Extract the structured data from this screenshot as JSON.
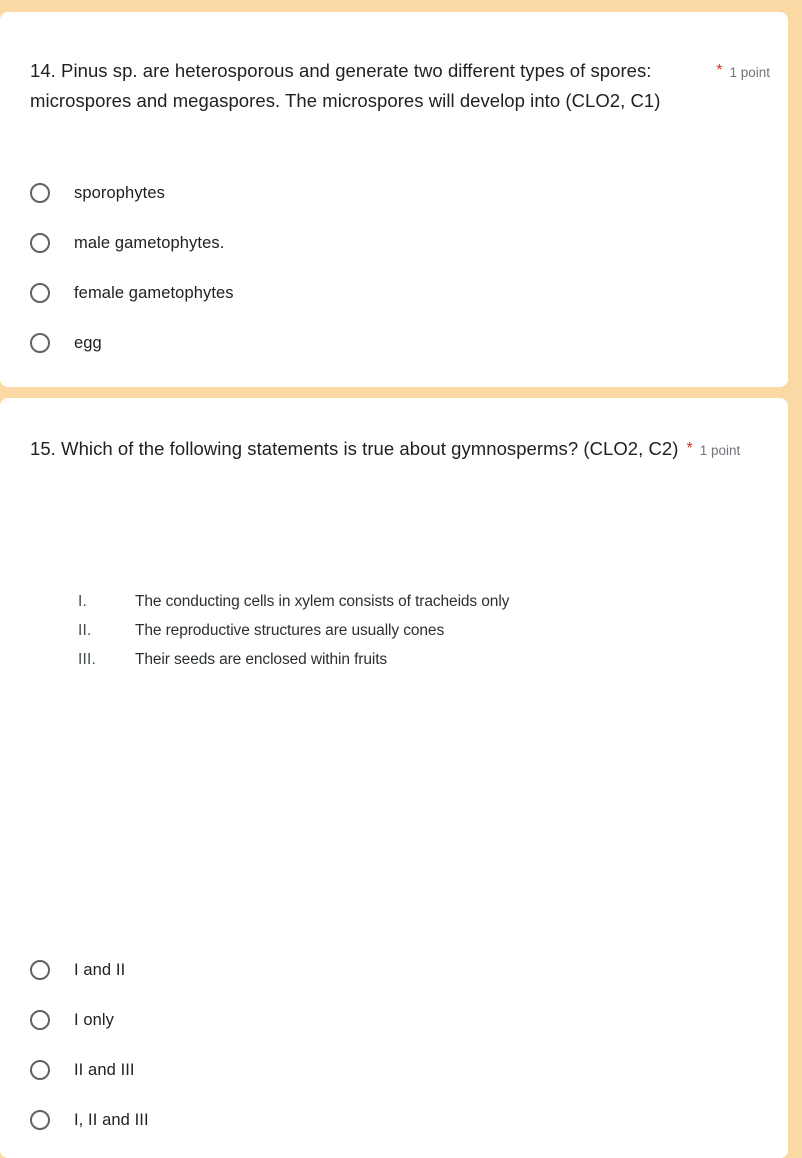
{
  "theme": {
    "page_background": "#fbd9a5",
    "card_background": "#ffffff",
    "text_color": "#202124",
    "required_asterisk_color": "#d93025",
    "points_color": "#70757a",
    "radio_border_color": "#5f6368"
  },
  "questions": [
    {
      "number": "14",
      "title": "14. Pinus sp. are heterosporous and generate two different types of spores: microspores and megaspores. The microspores will develop into (CLO2, C1)",
      "required_marker": "*",
      "points": "1 point",
      "options": [
        {
          "label": "sporophytes",
          "selected": false
        },
        {
          "label": "male gametophytes.",
          "selected": false
        },
        {
          "label": "female gametophytes",
          "selected": false
        },
        {
          "label": "egg",
          "selected": false
        }
      ]
    },
    {
      "number": "15",
      "title": "15. Which of the following statements is true about gymnosperms? (CLO2, C2)",
      "required_marker": "*",
      "points": "1 point",
      "embedded_image": {
        "kind": "scanned-text-image",
        "rows": [
          {
            "numeral": "I.",
            "text": "The conducting cells in xylem consists of tracheids only"
          },
          {
            "numeral": "II.",
            "text": "The reproductive structures are usually cones"
          },
          {
            "numeral": "III.",
            "text": "Their seeds are enclosed within fruits"
          }
        ]
      },
      "options": [
        {
          "label": "I and II",
          "selected": false
        },
        {
          "label": "I only",
          "selected": false
        },
        {
          "label": "II and III",
          "selected": false
        },
        {
          "label": "I, II and III",
          "selected": false
        }
      ]
    }
  ]
}
